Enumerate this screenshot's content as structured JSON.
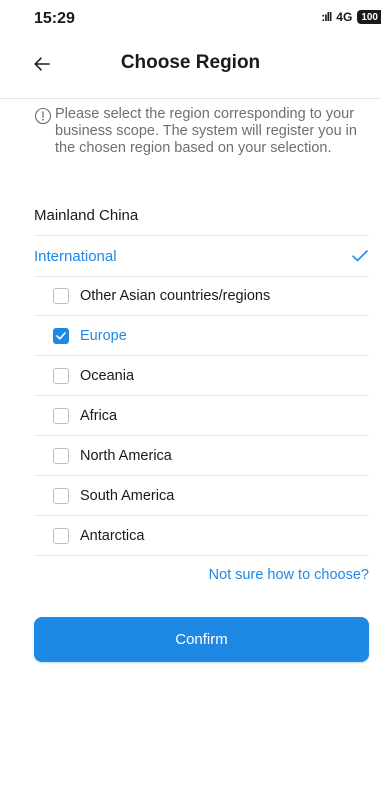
{
  "status_bar": {
    "time": "15:29",
    "signal": ":ıll",
    "network": "4G",
    "battery": "100"
  },
  "header": {
    "title": "Choose Region",
    "back_icon": "arrow-left-icon"
  },
  "notice": {
    "icon": "info-circle-icon",
    "text": "Please select the region corresponding to your business scope. The system will register you in the chosen region based on your selection."
  },
  "regions": [
    {
      "label": "Mainland China",
      "selected": false
    },
    {
      "label": "International",
      "selected": true
    }
  ],
  "sub_regions": [
    {
      "label": "Other Asian countries/regions",
      "checked": false
    },
    {
      "label": "Europe",
      "checked": true
    },
    {
      "label": "Oceania",
      "checked": false
    },
    {
      "label": "Africa",
      "checked": false
    },
    {
      "label": "North America",
      "checked": false
    },
    {
      "label": "South America",
      "checked": false
    },
    {
      "label": "Antarctica",
      "checked": false
    }
  ],
  "help_link": "Not sure how to choose?",
  "confirm_label": "Confirm",
  "colors": {
    "accent": "#1e88e5",
    "text": "#1a1a1a",
    "muted": "#6f6f6f",
    "divider": "#ececec"
  }
}
